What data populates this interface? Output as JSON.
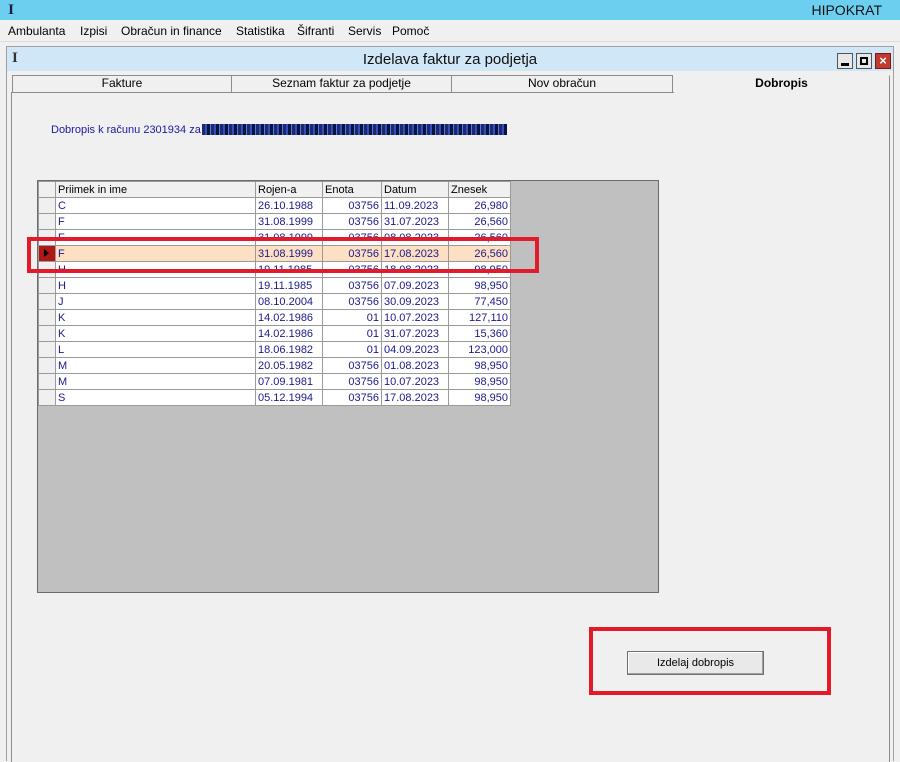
{
  "app": {
    "title": "HIPOKRAT",
    "icon": "app-logo-icon",
    "icon_glyph": "I"
  },
  "menu": [
    {
      "label": "Ambulanta"
    },
    {
      "label": "Izpisi"
    },
    {
      "label": "Obračun in finance"
    },
    {
      "label": "Statistika"
    },
    {
      "label": "Šifranti"
    },
    {
      "label": "Servis"
    },
    {
      "label": "Pomoč"
    }
  ],
  "window": {
    "title": "Izdelava faktur za podjetja",
    "icon": "window-logo-icon",
    "close_glyph": "×"
  },
  "tabs": [
    {
      "label": "Fakture",
      "active": false
    },
    {
      "label": "Seznam faktur za podjetje",
      "active": false
    },
    {
      "label": "Nov obračun",
      "active": false
    },
    {
      "label": "Dobropis",
      "active": true
    }
  ],
  "info": {
    "label": "Dobropis k računu 2301934 za"
  },
  "grid": {
    "columns": [
      "Priimek in ime",
      "Rojen-a",
      "Enota",
      "Datum",
      "Znesek"
    ],
    "rows": [
      {
        "name": "C",
        "born": "26.10.1988",
        "unit": "03756",
        "date": "11.09.2023",
        "amount": "26,980",
        "selected": false
      },
      {
        "name": "F",
        "born": "31.08.1999",
        "unit": "03756",
        "date": "31.07.2023",
        "amount": "26,560",
        "selected": false
      },
      {
        "name": "F",
        "born": "31.08.1999",
        "unit": "03756",
        "date": "08.08.2023",
        "amount": "26,560",
        "selected": false
      },
      {
        "name": "F",
        "born": "31.08.1999",
        "unit": "03756",
        "date": "17.08.2023",
        "amount": "26,560",
        "selected": true
      },
      {
        "name": "H",
        "born": "19.11.1985",
        "unit": "03756",
        "date": "18.08.2023",
        "amount": "98,950",
        "selected": false
      },
      {
        "name": "H",
        "born": "19.11.1985",
        "unit": "03756",
        "date": "07.09.2023",
        "amount": "98,950",
        "selected": false
      },
      {
        "name": "J",
        "born": "08.10.2004",
        "unit": "03756",
        "date": "30.09.2023",
        "amount": "77,450",
        "selected": false
      },
      {
        "name": "K",
        "born": "14.02.1986",
        "unit": "01",
        "date": "10.07.2023",
        "amount": "127,110",
        "selected": false
      },
      {
        "name": "K",
        "born": "14.02.1986",
        "unit": "01",
        "date": "31.07.2023",
        "amount": "15,360",
        "selected": false
      },
      {
        "name": "L",
        "born": "18.06.1982",
        "unit": "01",
        "date": "04.09.2023",
        "amount": "123,000",
        "selected": false
      },
      {
        "name": "M",
        "born": "20.05.1982",
        "unit": "03756",
        "date": "01.08.2023",
        "amount": "98,950",
        "selected": false
      },
      {
        "name": "M",
        "born": "07.09.1981",
        "unit": "03756",
        "date": "10.07.2023",
        "amount": "98,950",
        "selected": false
      },
      {
        "name": "S",
        "born": "05.12.1994",
        "unit": "03756",
        "date": "17.08.2023",
        "amount": "98,950",
        "selected": false
      }
    ]
  },
  "actions": {
    "create_credit_note": "Izdelaj dobropis"
  },
  "colors": {
    "title_bar": "#6dcff0",
    "highlight": "#e21b2a",
    "selected_row": "#fde0c4",
    "grid_text": "#1a1a8c"
  }
}
